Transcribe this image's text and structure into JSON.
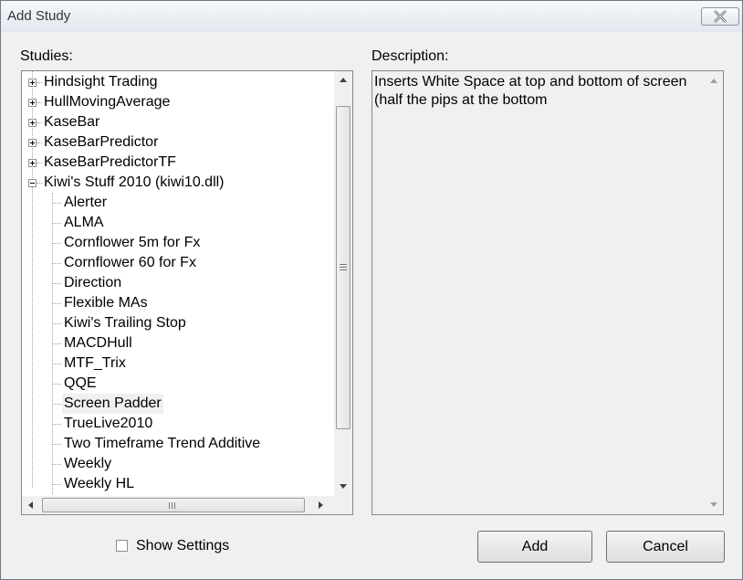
{
  "window": {
    "title": "Add Study",
    "close_icon": "close-icon"
  },
  "studies_label": "Studies:",
  "description_label": "Description:",
  "tree": {
    "groups": [
      {
        "label": "Hindsight Trading",
        "expanded": false
      },
      {
        "label": "HullMovingAverage",
        "expanded": false
      },
      {
        "label": "KaseBar",
        "expanded": false
      },
      {
        "label": "KaseBarPredictor",
        "expanded": false
      },
      {
        "label": "KaseBarPredictorTF",
        "expanded": false
      },
      {
        "label": "Kiwi's Stuff 2010 (kiwi10.dll)",
        "expanded": true
      }
    ],
    "children": [
      "Alerter",
      "ALMA",
      "Cornflower 5m for Fx",
      "Cornflower 60 for Fx",
      "Direction",
      "Flexible MAs",
      "Kiwi's Trailing Stop",
      "MACDHull",
      "MTF_Trix",
      "QQE",
      "Screen Padder",
      "TrueLive2010",
      "Two Timeframe Trend Additive",
      "Weekly",
      "Weekly HL"
    ],
    "selected": "Screen Padder"
  },
  "description": {
    "line1": "Inserts White Space at top and bottom of screen",
    "line2": "(half the pips at the bottom"
  },
  "show_settings": {
    "label": "Show Settings",
    "checked": false
  },
  "buttons": {
    "add": "Add",
    "cancel": "Cancel"
  }
}
